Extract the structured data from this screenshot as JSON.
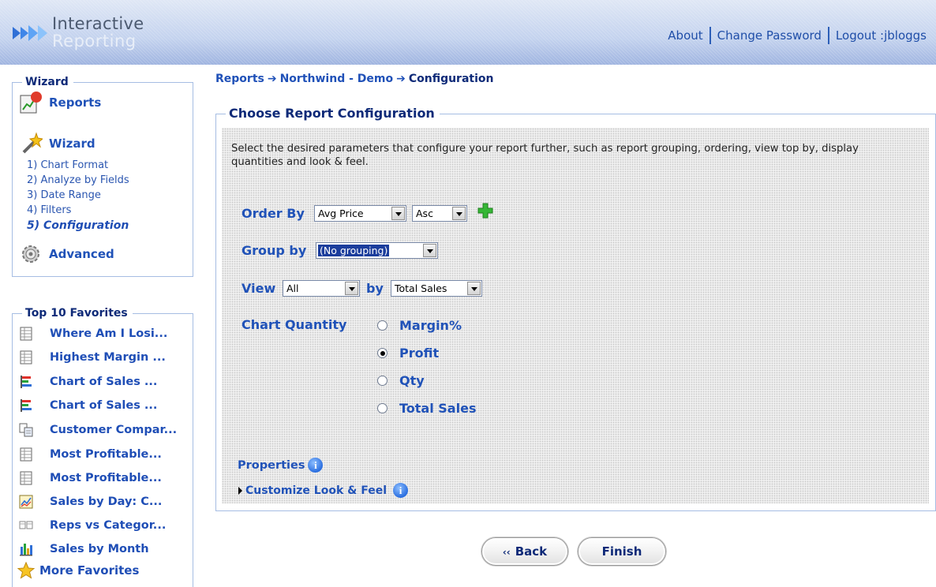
{
  "header": {
    "logo_line1": "Interactive",
    "logo_line2": "Reporting",
    "links": {
      "about": "About",
      "change_password": "Change Password",
      "logout": "Logout :jbloggs"
    }
  },
  "sidebar": {
    "wizard": {
      "legend": "Wizard",
      "reports_label": "Reports",
      "wizard_label": "Wizard",
      "steps": [
        "1) Chart Format",
        "2) Analyze by Fields",
        "3) Date Range",
        "4) Filters",
        "5) Configuration"
      ],
      "advanced_label": "Advanced"
    },
    "favorites": {
      "legend": "Top 10 Favorites",
      "items": [
        {
          "label": "Where Am I Losi...",
          "icon": "table-icon"
        },
        {
          "label": "Highest Margin ...",
          "icon": "table-icon"
        },
        {
          "label": "Chart of Sales ...",
          "icon": "bar-chart-icon"
        },
        {
          "label": "Chart of Sales ...",
          "icon": "bar-chart-icon"
        },
        {
          "label": "Customer Compar...",
          "icon": "compare-icon"
        },
        {
          "label": "Most Profitable...",
          "icon": "table-icon"
        },
        {
          "label": "Most Profitable...",
          "icon": "table-icon"
        },
        {
          "label": "Sales by Day: C...",
          "icon": "line-chart-icon"
        },
        {
          "label": "Reps vs Categor...",
          "icon": "pivot-icon"
        },
        {
          "label": "Sales by Month",
          "icon": "column-chart-icon"
        }
      ],
      "more_label": "More Favorites"
    }
  },
  "breadcrumb": {
    "reports": "Reports",
    "arrow": "➔",
    "report": "Northwind - Demo",
    "current": "Configuration"
  },
  "main": {
    "legend": "Choose Report Configuration",
    "description": "Select the desired parameters that configure your report further, such as report grouping, ordering, view top by, display quantities and look & feel.",
    "order_by": {
      "label": "Order By",
      "field": "Avg Price",
      "direction": "Asc"
    },
    "group_by": {
      "label": "Group by",
      "value": "(No grouping)"
    },
    "view": {
      "label": "View",
      "value": "All",
      "by_label": "by",
      "by_value": "Total Sales"
    },
    "chart_quantity": {
      "label": "Chart Quantity",
      "options": [
        "Margin%",
        "Profit",
        "Qty",
        "Total Sales"
      ],
      "selected": "Profit"
    },
    "properties_label": "Properties",
    "customize_label": "Customize Look & Feel",
    "info_glyph": "i"
  },
  "buttons": {
    "back": "Back",
    "back_chev": "‹‹",
    "finish": "Finish"
  },
  "colors": {
    "link": "#2052b8",
    "heading": "#0e2a78",
    "header_bg": "#c3d2ee"
  }
}
